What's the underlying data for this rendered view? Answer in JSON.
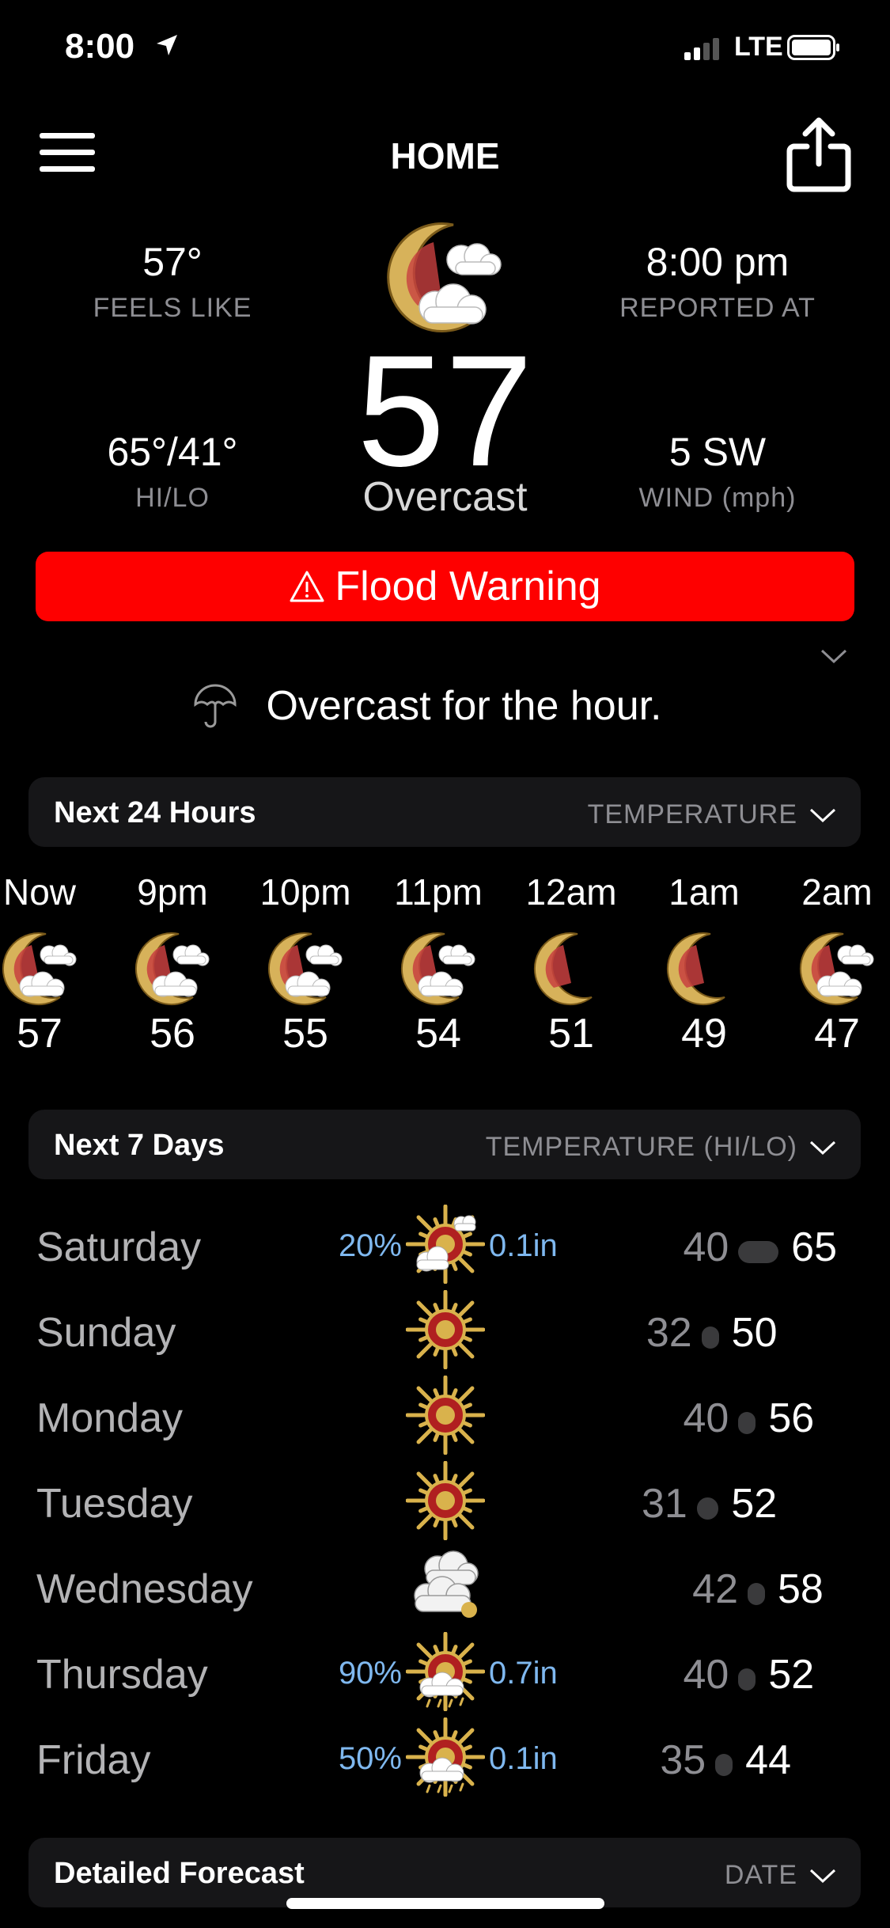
{
  "status": {
    "time": "8:00",
    "network": "LTE"
  },
  "header": {
    "title": "HOME"
  },
  "current": {
    "feels_like": "57°",
    "feels_like_label": "FEELS LIKE",
    "reported_at": "8:00 pm",
    "reported_at_label": "REPORTED AT",
    "hilo": "65°/41°",
    "hilo_label": "HI/LO",
    "wind": "5 SW",
    "wind_label": "WIND (mph)",
    "temp": "57",
    "condition": "Overcast"
  },
  "alert": {
    "icon": "warning-triangle-icon",
    "text": "Flood Warning",
    "color": "#fe0000"
  },
  "summary": {
    "text": "Overcast for the hour."
  },
  "hourly_section": {
    "title": "Next 24 Hours",
    "mode": "TEMPERATURE"
  },
  "hourly": [
    {
      "time": "Now",
      "temp": "57",
      "icon": "moon-cloud-icon"
    },
    {
      "time": "9pm",
      "temp": "56",
      "icon": "moon-cloud-icon"
    },
    {
      "time": "10pm",
      "temp": "55",
      "icon": "moon-cloud-icon"
    },
    {
      "time": "11pm",
      "temp": "54",
      "icon": "moon-cloud-icon"
    },
    {
      "time": "12am",
      "temp": "51",
      "icon": "moon-icon"
    },
    {
      "time": "1am",
      "temp": "49",
      "icon": "moon-icon"
    },
    {
      "time": "2am",
      "temp": "47",
      "icon": "moon-cloud-icon"
    }
  ],
  "daily_section": {
    "title": "Next 7 Days",
    "mode": "TEMPERATURE (HI/LO)"
  },
  "daily": [
    {
      "day": "Saturday",
      "pop": "20%",
      "precip": "0.1in",
      "lo": "40",
      "hi": "65",
      "icon": "sun-cloud-icon"
    },
    {
      "day": "Sunday",
      "pop": "",
      "precip": "",
      "lo": "32",
      "hi": "50",
      "icon": "sun-icon"
    },
    {
      "day": "Monday",
      "pop": "",
      "precip": "",
      "lo": "40",
      "hi": "56",
      "icon": "sun-icon"
    },
    {
      "day": "Tuesday",
      "pop": "",
      "precip": "",
      "lo": "31",
      "hi": "52",
      "icon": "sun-icon"
    },
    {
      "day": "Wednesday",
      "pop": "",
      "precip": "",
      "lo": "42",
      "hi": "58",
      "icon": "cloud-icon"
    },
    {
      "day": "Thursday",
      "pop": "90%",
      "precip": "0.7in",
      "lo": "40",
      "hi": "52",
      "icon": "sun-rain-icon"
    },
    {
      "day": "Friday",
      "pop": "50%",
      "precip": "0.1in",
      "lo": "35",
      "hi": "44",
      "icon": "sun-rain-icon"
    }
  ],
  "detailed_section": {
    "title": "Detailed Forecast",
    "mode": "DATE"
  }
}
